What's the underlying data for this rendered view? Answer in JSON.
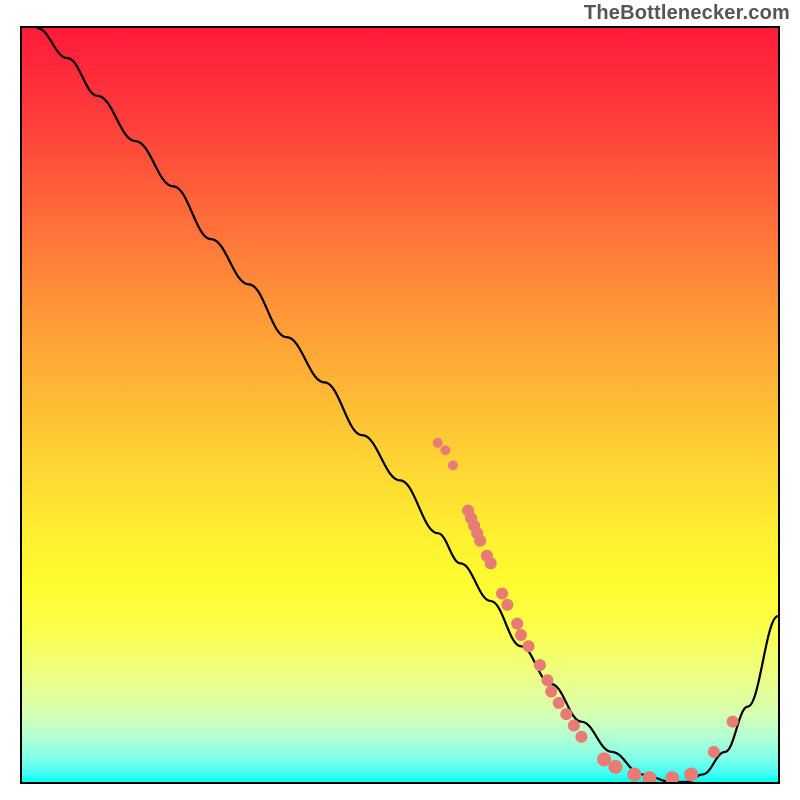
{
  "attribution": "TheBottlenecker.com",
  "chart_data": {
    "type": "line",
    "title": "",
    "xlabel": "",
    "ylabel": "",
    "xlim": [
      0,
      100
    ],
    "ylim": [
      0,
      100
    ],
    "grid": false,
    "series": [
      {
        "name": "curve",
        "color": "#000000",
        "x": [
          2,
          6,
          10,
          15,
          20,
          25,
          30,
          35,
          40,
          45,
          50,
          55,
          58,
          62,
          66,
          70,
          74,
          78,
          82,
          86,
          88,
          90,
          93,
          96,
          100
        ],
        "y": [
          100,
          96,
          91,
          85,
          79,
          72,
          66,
          59,
          53,
          46,
          40,
          33,
          29,
          24,
          18,
          13,
          8,
          4,
          1,
          0,
          0,
          1,
          4,
          10,
          22
        ]
      }
    ],
    "scatter": [
      {
        "name": "cluster-upper",
        "color": "#e87c74",
        "r": 5,
        "points": [
          {
            "x": 55,
            "y": 45
          },
          {
            "x": 56,
            "y": 44
          },
          {
            "x": 57,
            "y": 42
          }
        ]
      },
      {
        "name": "cluster-mid",
        "color": "#e87c74",
        "r": 6,
        "points": [
          {
            "x": 59,
            "y": 36
          },
          {
            "x": 59.4,
            "y": 35
          },
          {
            "x": 59.8,
            "y": 34
          },
          {
            "x": 60.2,
            "y": 33
          },
          {
            "x": 60.6,
            "y": 32
          },
          {
            "x": 61.5,
            "y": 30
          },
          {
            "x": 62,
            "y": 29
          }
        ]
      },
      {
        "name": "cluster-slope",
        "color": "#e87c74",
        "r": 6,
        "points": [
          {
            "x": 63.5,
            "y": 25
          },
          {
            "x": 64.2,
            "y": 23.5
          },
          {
            "x": 65.5,
            "y": 21
          },
          {
            "x": 66,
            "y": 19.5
          },
          {
            "x": 67,
            "y": 18
          },
          {
            "x": 68.5,
            "y": 15.5
          },
          {
            "x": 69.5,
            "y": 13.5
          },
          {
            "x": 70,
            "y": 12
          },
          {
            "x": 71,
            "y": 10.5
          },
          {
            "x": 72,
            "y": 9
          },
          {
            "x": 73,
            "y": 7.5
          },
          {
            "x": 74,
            "y": 6
          }
        ]
      },
      {
        "name": "cluster-valley",
        "color": "#e87c74",
        "r": 7,
        "points": [
          {
            "x": 77,
            "y": 3
          },
          {
            "x": 78.5,
            "y": 2
          },
          {
            "x": 81,
            "y": 1
          },
          {
            "x": 83,
            "y": 0.5
          },
          {
            "x": 86,
            "y": 0.5
          },
          {
            "x": 88.5,
            "y": 1
          }
        ]
      },
      {
        "name": "cluster-upslope",
        "color": "#e87c74",
        "r": 6,
        "points": [
          {
            "x": 91.5,
            "y": 4
          },
          {
            "x": 94,
            "y": 8
          }
        ]
      }
    ]
  }
}
